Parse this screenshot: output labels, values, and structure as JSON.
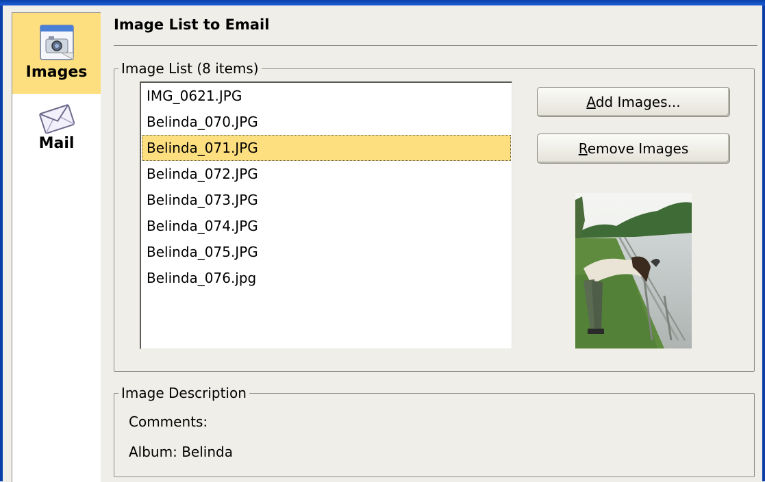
{
  "sidebar": {
    "items": [
      {
        "label": "Images",
        "icon": "camera-icon",
        "active": true
      },
      {
        "label": "Mail",
        "icon": "envelope-icon",
        "active": false
      }
    ]
  },
  "page": {
    "title": "Image List to Email"
  },
  "image_list": {
    "legend": "Image List (8 items)",
    "items": [
      "IMG_0621.JPG",
      "Belinda_070.JPG",
      "Belinda_071.JPG",
      "Belinda_072.JPG",
      "Belinda_073.JPG",
      "Belinda_074.JPG",
      "Belinda_075.JPG",
      "Belinda_076.jpg"
    ],
    "selected": "Belinda_071.JPG"
  },
  "buttons": {
    "add": {
      "mnemonic": "A",
      "rest": "dd Images..."
    },
    "remove": {
      "mnemonic": "R",
      "rest": "emove Images"
    }
  },
  "description": {
    "legend": "Image Description",
    "comments": "Comments:",
    "album": "Album: Belinda"
  },
  "colors": {
    "selection": "#fedf80",
    "window_accent": "#0a3fa8"
  }
}
